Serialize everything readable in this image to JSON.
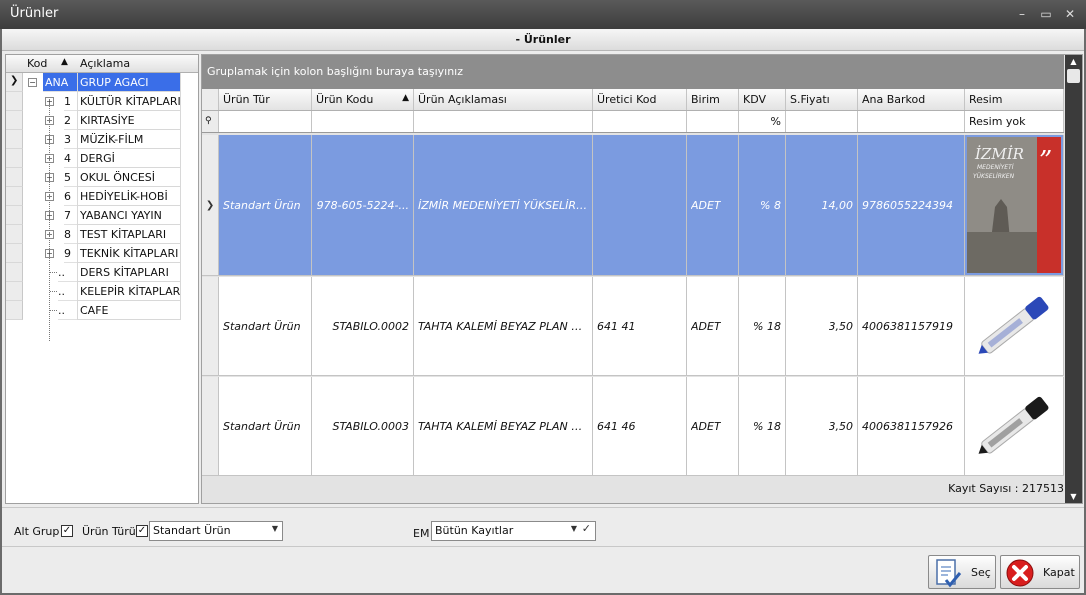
{
  "window": {
    "title": "Ürünler"
  },
  "subheader": {
    "title": "- Ürünler"
  },
  "tree": {
    "col_kod": "Kod",
    "col_aciklama": "Açıklama",
    "items": [
      {
        "kod": "ANA",
        "label": "GRUP AGACI"
      },
      {
        "kod": "1",
        "label": "KÜLTÜR KİTAPLARI"
      },
      {
        "kod": "2",
        "label": "KIRTASİYE"
      },
      {
        "kod": "3",
        "label": "MÜZİK-FİLM"
      },
      {
        "kod": "4",
        "label": "DERGİ"
      },
      {
        "kod": "5",
        "label": "OKUL ÖNCESİ"
      },
      {
        "kod": "6",
        "label": "HEDİYELİK-HOBİ"
      },
      {
        "kod": "7",
        "label": "YABANCI YAYIN"
      },
      {
        "kod": "8",
        "label": "TEST KİTAPLARI"
      },
      {
        "kod": "9",
        "label": "TEKNİK KİTAPLARI"
      },
      {
        "kod": "..",
        "label": "DERS KİTAPLARI"
      },
      {
        "kod": "..",
        "label": "KELEPİR KİTAPLAR"
      },
      {
        "kod": "..",
        "label": "CAFE"
      }
    ]
  },
  "grid": {
    "group_hint": "Gruplamak için kolon başlığını buraya taşıyınız",
    "columns": [
      "Ürün Tür",
      "Ürün Kodu",
      "Ürün Açıklaması",
      "Üretici Kod",
      "Birim",
      "KDV",
      "S.Fiyatı",
      "Ana Barkod",
      "Resim"
    ],
    "filter": {
      "kdv": "%",
      "resim": "Resim yok"
    },
    "rows": [
      {
        "tur": "Standart Ürün",
        "kod": "978-605-5224-...",
        "aciklama": "İZMİR MEDENİYETİ YÜKSELİRKE ...",
        "uretici": "",
        "birim": "ADET",
        "kdv": "% 8",
        "fiyat": "14,00",
        "barkod": "9786055224394",
        "resim": "book-cover-image"
      },
      {
        "tur": "Standart Ürün",
        "kod": "STABILO.0002",
        "aciklama": "TAHTA KALEMİ BEYAZ PLAN 64 ...",
        "uretici": "641 41",
        "birim": "ADET",
        "kdv": "% 18",
        "fiyat": "3,50",
        "barkod": "4006381157919",
        "resim": "blue-marker-image"
      },
      {
        "tur": "Standart Ürün",
        "kod": "STABILO.0003",
        "aciklama": "TAHTA KALEMİ BEYAZ PLAN 64 S ...",
        "uretici": "641 46",
        "birim": "ADET",
        "kdv": "% 18",
        "fiyat": "3,50",
        "barkod": "4006381157926",
        "resim": "black-marker-image"
      }
    ],
    "record_count": "Kayıt Sayısı : 217513",
    "cover": {
      "line1": "İZMİR",
      "line2": "MEDENİYETİ",
      "line3": "YÜKSELİRKEN"
    }
  },
  "filters": {
    "alt_grup_label": "Alt Grup",
    "alt_grup_checked": true,
    "urun_turu_label": "Ürün Türü",
    "urun_turu_checked": true,
    "urun_turu_value": "Standart Ürün",
    "em_label": "EM",
    "em_value": "Bütün Kayıtlar"
  },
  "buttons": {
    "sec": "Seç",
    "kapat": "Kapat"
  },
  "colors": {
    "selection": "#7b9be0",
    "tree_selection": "#3a6ee8",
    "groupbar": "#8d8d8d",
    "close_red": "#d81e1e"
  }
}
